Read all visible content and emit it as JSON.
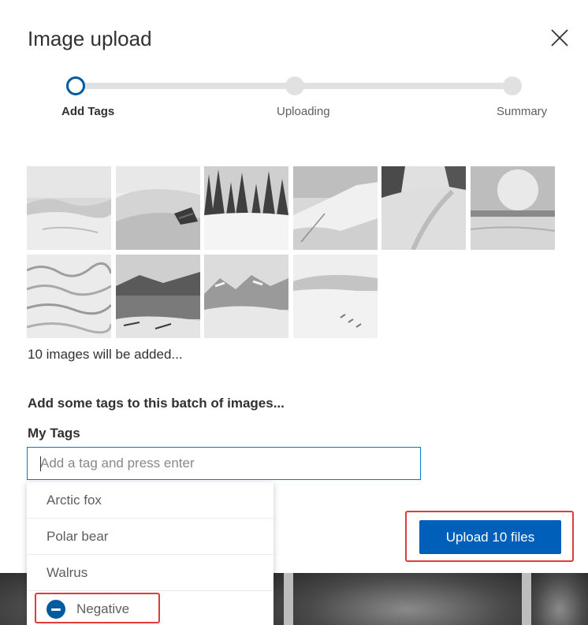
{
  "dialog": {
    "title": "Image upload",
    "close_icon": "close-icon"
  },
  "stepper": {
    "steps": [
      {
        "label": "Add Tags",
        "state": "active"
      },
      {
        "label": "Uploading",
        "state": "pending"
      },
      {
        "label": "Summary",
        "state": "pending"
      }
    ]
  },
  "thumbnails": {
    "count_text": "10 images will be added...",
    "items": [
      {
        "name": "snow-hills"
      },
      {
        "name": "snow-dune-rock"
      },
      {
        "name": "snowy-forest"
      },
      {
        "name": "snow-ridge"
      },
      {
        "name": "snow-forest-path"
      },
      {
        "name": "snow-field-sun"
      },
      {
        "name": "snow-texture"
      },
      {
        "name": "frozen-lake"
      },
      {
        "name": "snowy-mountains"
      },
      {
        "name": "snow-slope-tracks"
      }
    ]
  },
  "tags": {
    "instruction": "Add some tags to this batch of images...",
    "label": "My Tags",
    "input_value": "",
    "input_placeholder": "Add a tag and press enter",
    "suggestions": [
      "Arctic fox",
      "Polar bear",
      "Walrus"
    ],
    "negative_label": "Negative"
  },
  "actions": {
    "upload_label": "Upload 10 files"
  },
  "colors": {
    "accent": "#005fb8",
    "highlight": "#e03c3c"
  }
}
